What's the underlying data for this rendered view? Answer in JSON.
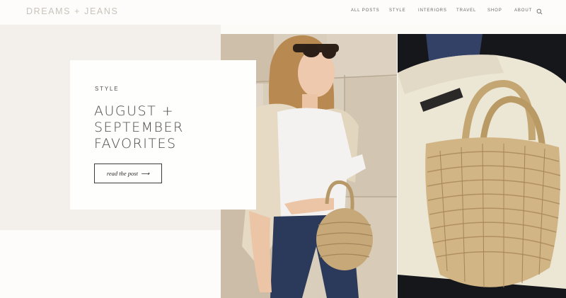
{
  "site": {
    "logo": "DREAMS + JEANS"
  },
  "nav": {
    "items": [
      {
        "label": "ALL POSTS"
      },
      {
        "label": "STYLE"
      },
      {
        "label": "INTERIORS"
      },
      {
        "label": "TRAVEL"
      },
      {
        "label": "SHOP"
      },
      {
        "label": "ABOUT"
      }
    ],
    "search_icon": "search-icon"
  },
  "hero": {
    "category": "STYLE",
    "title_lines": [
      "AUGUST +",
      "SEPTEMBER",
      "FAVORITES"
    ],
    "cta_label": "read the post",
    "cta_arrow": "⟶"
  },
  "photos": {
    "left": "woman-in-white-tee-with-straw-bag",
    "right": "straw-tote-on-cream-sweater"
  },
  "colors": {
    "page_bg": "#fcfbf8",
    "band_bg": "#f3efea",
    "card_bg": "#fefefc",
    "text_dark": "#4b4845",
    "logo": "#c9c3bb"
  }
}
